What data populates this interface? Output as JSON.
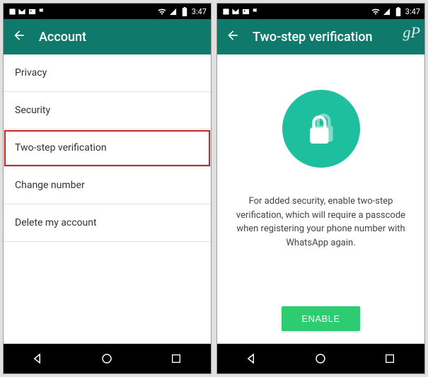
{
  "status": {
    "time": "3:47"
  },
  "left": {
    "title": "Account",
    "items": [
      {
        "label": "Privacy"
      },
      {
        "label": "Security"
      },
      {
        "label": "Two-step verification",
        "highlighted": true
      },
      {
        "label": "Change number"
      },
      {
        "label": "Delete my account"
      }
    ]
  },
  "right": {
    "title": "Two-step verification",
    "body": "For added security, enable two-step verification, which will require a passcode when registering your phone number with WhatsApp again.",
    "enable_label": "ENABLE",
    "logo": "gP"
  }
}
